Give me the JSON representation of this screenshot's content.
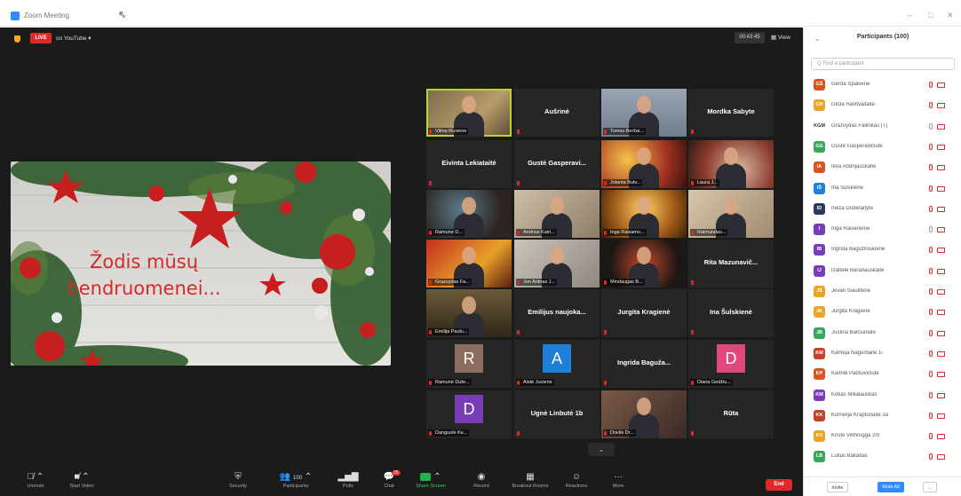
{
  "window": {
    "title": "Zoom Meeting"
  },
  "topbar": {
    "live_label": "LIVE",
    "on_label": "on YouTube ▾",
    "timer": "00:43:45",
    "view_label": "▦ View"
  },
  "shared_screen": {
    "text_line1": "Žodis mūsų",
    "text_line2": "bendruomenei..."
  },
  "gallery": [
    {
      "name": "Vilma Rusiene",
      "kind": "photo",
      "photo": "ph1",
      "speaking": true
    },
    {
      "name": "Aušrinė",
      "kind": "name"
    },
    {
      "name": "Tomas Beržai...",
      "kind": "photo",
      "photo": "ph2"
    },
    {
      "name": "Mordka Sabyte",
      "kind": "name"
    },
    {
      "name": "Eivinta Lekiataitė",
      "kind": "name"
    },
    {
      "name": "Gustė Gasperavi...",
      "kind": "name"
    },
    {
      "name": "Jolanta Butv...",
      "kind": "photo",
      "photo": "ph3"
    },
    {
      "name": "Laura J...",
      "kind": "photo",
      "photo": "ph4"
    },
    {
      "name": "Ramune D...",
      "kind": "photo",
      "photo": "ph5"
    },
    {
      "name": "Andrius Kairi...",
      "kind": "photo",
      "photo": "ph6"
    },
    {
      "name": "Inga Raisamo...",
      "kind": "photo",
      "photo": "ph7"
    },
    {
      "name": "Raimundas...",
      "kind": "photo",
      "photo": "ph8"
    },
    {
      "name": "Grazvydas Fa...",
      "kind": "photo",
      "photo": "ph9"
    },
    {
      "name": "Jon Antnas J...",
      "kind": "photo",
      "photo": "ph10"
    },
    {
      "name": "Mindaugas B...",
      "kind": "photo",
      "photo": "ph11"
    },
    {
      "name": "Rita Mazunavič...",
      "kind": "name"
    },
    {
      "name": "Emilija Paulu...",
      "kind": "photo",
      "photo": "ph12"
    },
    {
      "name": "Emilijus naujoka...",
      "kind": "name"
    },
    {
      "name": "Jurgita Kragienė",
      "kind": "name"
    },
    {
      "name": "Ina Šulskienė",
      "kind": "name"
    },
    {
      "name": "Ramunė Dubr...",
      "kind": "avatar",
      "letter": "R",
      "color": "#8b6e5e"
    },
    {
      "name": "Aistė Juciene",
      "kind": "avatar",
      "letter": "A",
      "color": "#1d7fd6"
    },
    {
      "name": "Ingrida Baguža...",
      "kind": "name"
    },
    {
      "name": "Diana Gedžiu...",
      "kind": "avatar",
      "letter": "D",
      "color": "#e0487a"
    },
    {
      "name": "Danguolė Ke...",
      "kind": "avatar",
      "letter": "D",
      "color": "#7a3db8"
    },
    {
      "name": "Ugnė Linbutė 1b",
      "kind": "name"
    },
    {
      "name": "Dovilė Dr...",
      "kind": "photo",
      "photo": "ph13"
    },
    {
      "name": "Rūta",
      "kind": "name"
    }
  ],
  "toolbar": {
    "unmute": "Unmute",
    "start_video": "Start Video",
    "security": "Security",
    "participants": "Participants",
    "participants_count": "100",
    "polls": "Polls",
    "chat": "Chat",
    "chat_badge": "25",
    "share_screen": "Share Screen",
    "record": "Record",
    "breakout": "Breakout Rooms",
    "reactions": "Reactions",
    "more": "More",
    "end": "End"
  },
  "panel": {
    "title": "Participants (100)",
    "search_placeholder": "Q Find a participant",
    "invite": "Invite",
    "mute_all": "Mute All",
    "more": "..."
  },
  "participants": [
    {
      "initials": "GŠ",
      "name": "Gerda Špakienė",
      "color": "#d9541e",
      "muted": true
    },
    {
      "initials": "GN",
      "name": "Girda Ravitvaitaitė",
      "color": "#e8a52a",
      "muted": true
    },
    {
      "initials": "KGM",
      "name": "Grazvydas Fallinkas (T)",
      "color": "#ffffff",
      "muted": false,
      "textcolor": "#333"
    },
    {
      "initials": "GG",
      "name": "Gustė Gasperavičiūtė",
      "color": "#3aa55c",
      "muted": true
    },
    {
      "initials": "IA",
      "name": "Ieva Andrijauskaitė",
      "color": "#d9541e",
      "muted": true
    },
    {
      "initials": "IŠ",
      "name": "Ina Šulskienė",
      "color": "#1d7fd6",
      "muted": true
    },
    {
      "initials": "ID",
      "name": "Ineza Dūderaitytė",
      "color": "#2a3a5c",
      "muted": true
    },
    {
      "initials": "I",
      "name": "Inga Raisenienė",
      "color": "#7a3db8",
      "muted": false
    },
    {
      "initials": "IB",
      "name": "Ingrida Bagužiniskienė",
      "color": "#7a3db8",
      "muted": true
    },
    {
      "initials": "IJ",
      "name": "Izabelė Baranauskaitė",
      "color": "#7a3db8",
      "muted": true
    },
    {
      "initials": "JŠ",
      "name": "Jevan Šiaulitėnė",
      "color": "#e8a52a",
      "muted": true
    },
    {
      "initials": "JK",
      "name": "Jurgita Kragienė",
      "color": "#e8a52a",
      "muted": true
    },
    {
      "initials": "JB",
      "name": "Justina Balčiūnaitė",
      "color": "#3aa55c",
      "muted": true
    },
    {
      "initials": "KM",
      "name": "Kamėja Nagurbaitė 1i",
      "color": "#c4412a",
      "muted": true
    },
    {
      "initials": "KP",
      "name": "Kamilė Pačkuvičiūtė",
      "color": "#d9541e",
      "muted": true
    },
    {
      "initials": "KM",
      "name": "Kokas Mikalauskas",
      "color": "#7a3db8",
      "muted": true
    },
    {
      "initials": "KK",
      "name": "Kornelija Kraptūnaitė 3a",
      "color": "#c4412a",
      "muted": true
    },
    {
      "initials": "KV",
      "name": "Kristė Vethrugga 2m",
      "color": "#e8a52a",
      "muted": true
    },
    {
      "initials": "LB",
      "name": "Lukas Bakaitas",
      "color": "#3aa55c",
      "muted": true
    }
  ]
}
